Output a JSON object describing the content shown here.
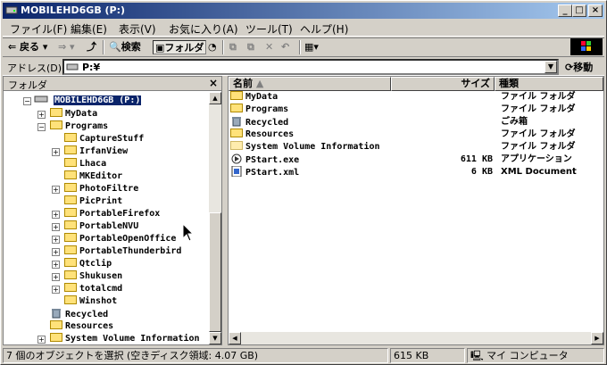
{
  "window": {
    "title": "MOBILEHD6GB (P:)"
  },
  "menu": [
    "ファイル(F)",
    "編集(E)",
    "表示(V)",
    "お気に入り(A)",
    "ツール(T)",
    "ヘルプ(H)"
  ],
  "toolbar": {
    "back": "戻る",
    "search": "検索",
    "folders": "フォルダ"
  },
  "address": {
    "label": "アドレス(D)",
    "value": "P:¥",
    "go": "移動"
  },
  "folder_pane": {
    "title": "フォルダ",
    "root": "MOBILEHD6GB (P:)",
    "items": [
      "MyData",
      "Programs",
      "CaptureStuff",
      "IrfanView",
      "Lhaca",
      "MKEditor",
      "PhotoFiltre",
      "PicPrint",
      "PortableFirefox",
      "PortableNVU",
      "PortableOpenOffice",
      "PortableThunderbird",
      "Qtclip",
      "Shukusen",
      "totalcmd",
      "Winshot",
      "Recycled",
      "Resources",
      "System Volume Information"
    ]
  },
  "list": {
    "headers": {
      "name": "名前",
      "size": "サイズ",
      "type": "種類"
    },
    "rows": [
      {
        "name": "MyData",
        "size": "",
        "type": "ファイル フォルダ",
        "icon": "folder-icon"
      },
      {
        "name": "Programs",
        "size": "",
        "type": "ファイル フォルダ",
        "icon": "folder-icon"
      },
      {
        "name": "Recycled",
        "size": "",
        "type": "ごみ箱",
        "icon": "recycle-bin-icon"
      },
      {
        "name": "Resources",
        "size": "",
        "type": "ファイル フォルダ",
        "icon": "folder-icon"
      },
      {
        "name": "System Volume Information",
        "size": "",
        "type": "ファイル フォルダ",
        "icon": "folder-icon"
      },
      {
        "name": "PStart.exe",
        "size": "611 KB",
        "type": "アプリケーション",
        "icon": "application-icon"
      },
      {
        "name": "PStart.xml",
        "size": "6 KB",
        "type": "XML Document",
        "icon": "xml-file-icon"
      }
    ]
  },
  "status": {
    "selection": "7 個のオブジェクトを選択 (空きディスク領域: 4.07 GB)",
    "size": "615 KB",
    "location": "マイ コンピュータ"
  },
  "colors": {
    "title_start": "#0a246a",
    "title_end": "#a6caf0",
    "selection": "#0a246a",
    "folder": "#ffe27a"
  }
}
